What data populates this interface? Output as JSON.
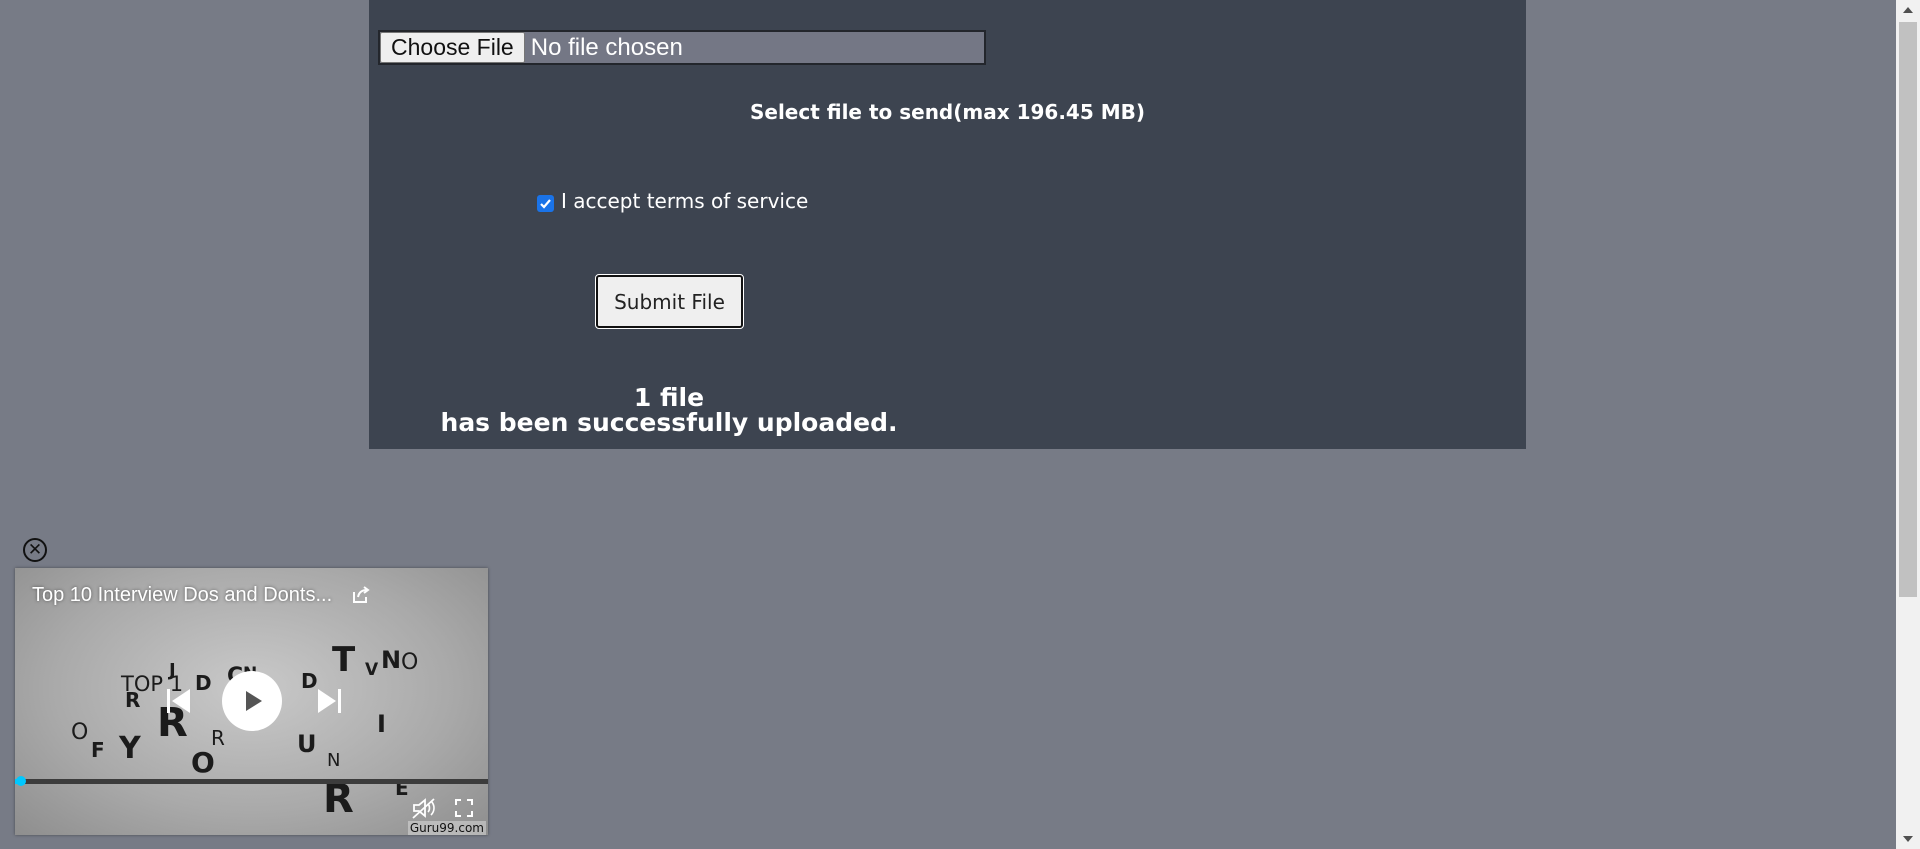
{
  "upload_form": {
    "choose_file_label": "Choose File",
    "file_status": "No file chosen",
    "select_label": "Select file to send(max 196.45 MB)",
    "terms_label": "I accept terms of service",
    "terms_checked": true,
    "submit_label": "Submit File",
    "result_line1": "1 file",
    "result_line2": "has been successfully uploaded."
  },
  "video_player": {
    "title": "Top 10 Interview Dos and Donts...",
    "brand": "Guru99.com",
    "progress_fraction": 0.01,
    "accent_color": "#00c8ff",
    "icons": [
      "close-icon",
      "share-icon",
      "previous-icon",
      "play-icon",
      "next-icon",
      "mute-icon",
      "fullscreen-icon"
    ],
    "thumbnail_text": {
      "top_label": "TOP 1",
      "letters": [
        "J",
        "D",
        "C",
        "N",
        "D",
        "T",
        "V",
        "N",
        "O",
        "R",
        "B",
        "R",
        "O",
        "F",
        "Y",
        "R",
        "O",
        "U",
        "N",
        "I",
        "R",
        "E",
        "E"
      ]
    }
  },
  "colors": {
    "page_background": "#777b86",
    "panel_background": "#3d4450"
  }
}
